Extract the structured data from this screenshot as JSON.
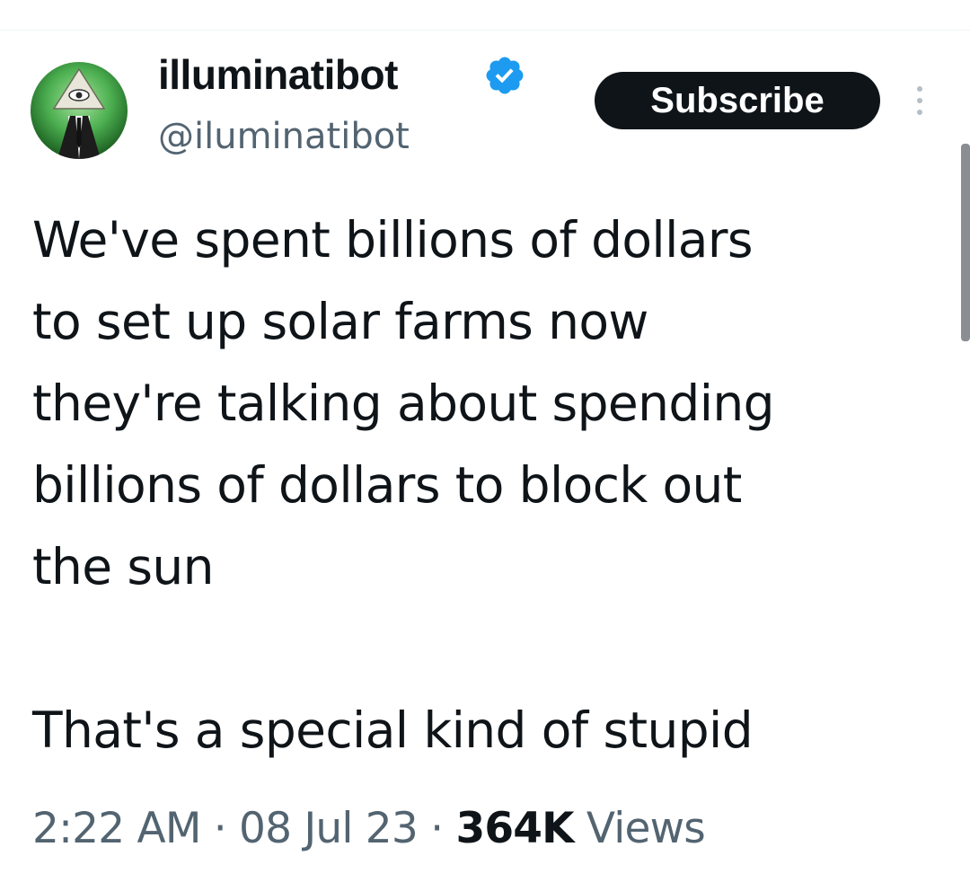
{
  "author": {
    "display_name": "illuminatibot",
    "handle": "@iluminatibot",
    "verified_icon": "verified-badge-icon",
    "avatar_icon": "all-seeing-eye-pyramid-avatar"
  },
  "actions": {
    "subscribe_label": "Subscribe",
    "more_icon": "more-vertical-icon"
  },
  "tweet": {
    "lines": [
      "We've spent billions of dollars",
      "to set up solar farms now",
      "they're talking about spending",
      "billions of dollars to block out",
      "the sun"
    ],
    "closing_line": "That's a special kind of stupid"
  },
  "meta": {
    "time": "2:22 AM",
    "separator": "·",
    "date": "08 Jul 23",
    "views_count": "364K",
    "views_label": "Views"
  },
  "colors": {
    "text_primary": "#0f1419",
    "text_secondary": "#536471",
    "verified_blue": "#1d9bf0",
    "button_bg": "#0f1419"
  }
}
